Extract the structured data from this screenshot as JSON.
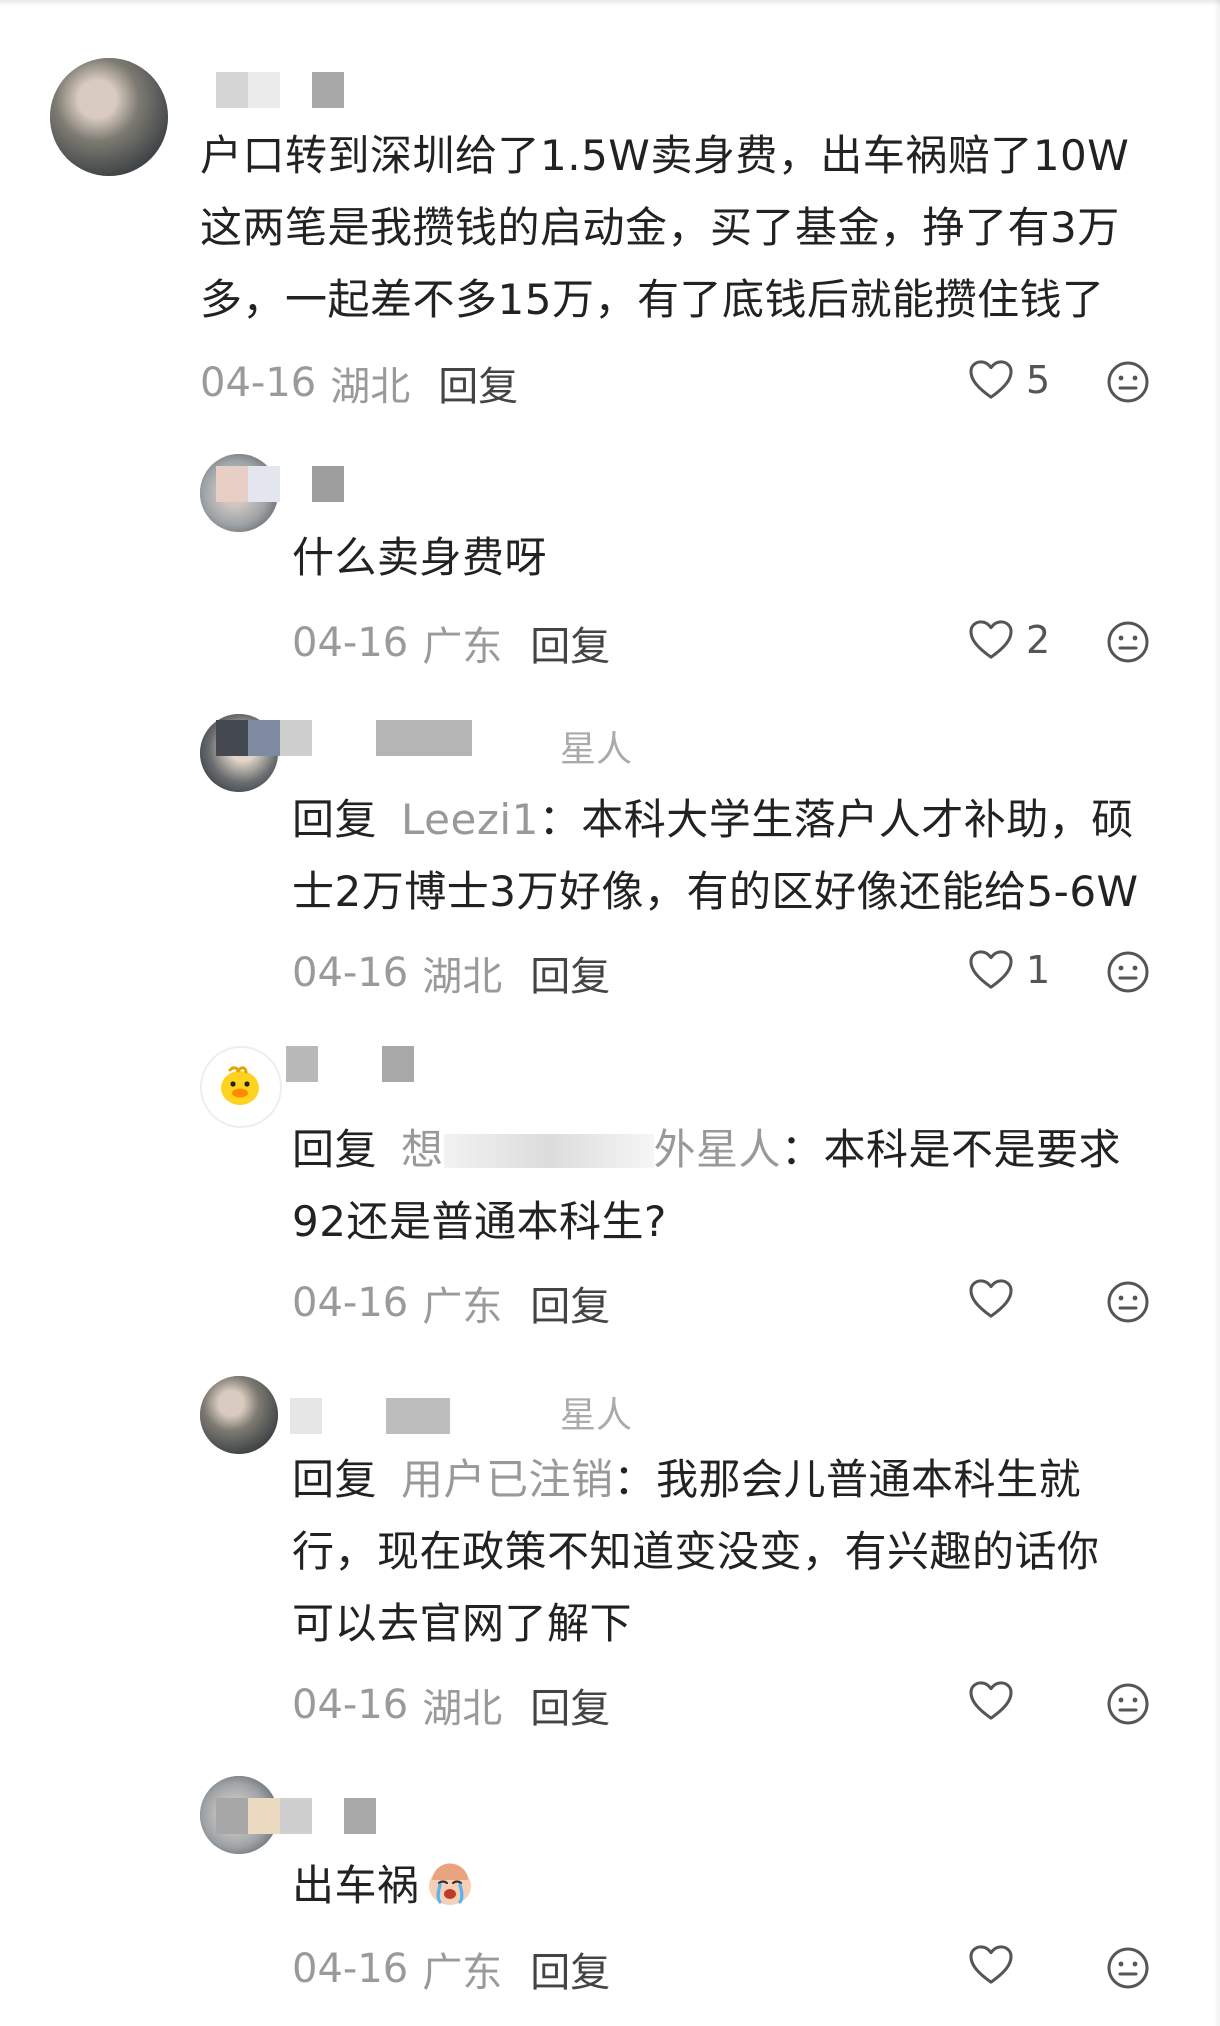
{
  "comments": [
    {
      "body": "户口转到深圳给了1.5W卖身费，出车祸赔了10W这两笔是我攒钱的启动金，买了基金，挣了有3万多，一起差不多15万，有了底钱后就能攒住钱了",
      "lines": [
        "户口转到深圳给了1.5W卖身费，出车祸赔了10W",
        "这两笔是我攒钱的启动金，买了基金，挣了有3万",
        "多，一起差不多15万，有了底钱后就能攒住钱了"
      ],
      "date": "04-16",
      "region": "湖北",
      "reply_label": "回复",
      "likes": "5"
    },
    {
      "body": "什么卖身费呀",
      "lines": [
        "什么卖身费呀"
      ],
      "date": "04-16",
      "region": "广东",
      "reply_label": "回复",
      "likes": "2"
    },
    {
      "name_fragment": "星人",
      "reply_prefix": "回复",
      "reply_target": "Leezi1",
      "lines": [
        "：本科大学生落户人才补助，硕",
        "士2万博士3万好像，有的区好像还能给5-6W"
      ],
      "date": "04-16",
      "region": "湖北",
      "reply_label": "回复",
      "likes": "1"
    },
    {
      "reply_prefix": "回复",
      "reply_target": "想",
      "reply_target_tail": "外星人",
      "lines": [
        "：本科是不是要求",
        "92还是普通本科生?"
      ],
      "date": "04-16",
      "region": "广东",
      "reply_label": "回复",
      "likes": ""
    },
    {
      "name_fragment": "星人",
      "reply_prefix": "回复",
      "reply_target": "用户已注销",
      "lines": [
        "：我那会儿普通本科生就",
        "行，现在政策不知道变没变，有兴趣的话你",
        "可以去官网了解下"
      ],
      "date": "04-16",
      "region": "湖北",
      "reply_label": "回复",
      "likes": ""
    },
    {
      "body": "出车祸",
      "lines": [
        "出车祸"
      ],
      "emoji": "crying-emoji",
      "date": "04-16",
      "region": "广东",
      "reply_label": "回复",
      "likes": ""
    }
  ],
  "icons": {
    "like": "heart-outline-icon",
    "dislike": "neutral-face-icon"
  },
  "colors": {
    "text": "#222222",
    "meta": "#9a9a9a",
    "reply_target": "#999999",
    "icon": "#555555"
  }
}
